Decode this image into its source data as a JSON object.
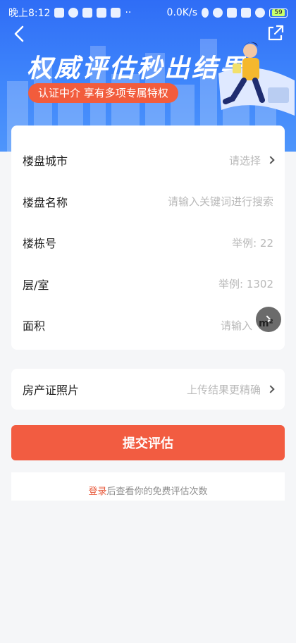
{
  "status_bar": {
    "time": "晚上8:12",
    "network_speed": "0.0K/s",
    "battery": "59"
  },
  "header": {
    "title": "权威评估秒出结果",
    "badge": "认证中介 享有多项专属特权"
  },
  "form": {
    "rows": [
      {
        "label": "楼盘城市",
        "value": "请选择"
      },
      {
        "label": "楼盘名称",
        "value": "请输入关键词进行搜索"
      },
      {
        "label": "楼栋号",
        "value": "举例: 22"
      },
      {
        "label": "层/室",
        "value": "举例: 1302"
      },
      {
        "label": "面积",
        "value": "请输入",
        "unit": "m²"
      }
    ]
  },
  "certificate": {
    "label": "房产证照片",
    "value": "上传结果更精确"
  },
  "submit_label": "提交评估",
  "footer": {
    "login": "登录",
    "text": "后查看你的免费评估次数"
  },
  "colors": {
    "primary_blue": "#2f6df6",
    "accent_orange": "#f25c41"
  },
  "icons": {
    "back": "back-arrow-icon",
    "share": "share-icon",
    "chevron": "chevron-right-icon"
  }
}
